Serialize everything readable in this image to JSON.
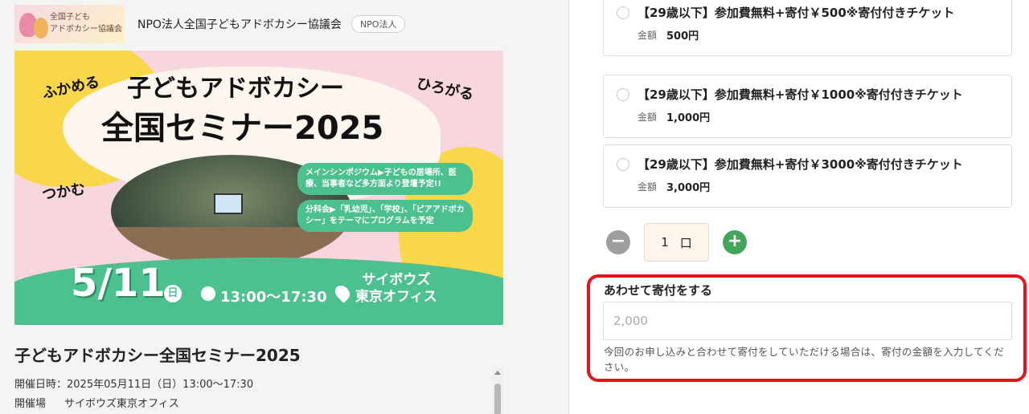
{
  "organizer": {
    "logo_text": [
      "全国子ども",
      "アドボカシー協議会"
    ],
    "name": "NPO法人全国子どもアドボカシー協議会",
    "badge": "NPO法人"
  },
  "banner": {
    "title_line1": "子どもアドボカシー",
    "title_line2": "全国セミナー2025",
    "word_left": "ふかめる",
    "word_right": "ひろがる",
    "word_lower": "つかむ",
    "pill1": "メインシンポジウム▶子どもの居場所、医療、当事者など多方面より登壇予定!!",
    "pill2": "分科会▶「乳幼児」、「学校」、「ピアアドボカシー」をテーマにプログラムを予定",
    "date": "5/11",
    "day": "日",
    "time": "13:00〜17:30",
    "venue_line1": "サイボウズ",
    "venue_line2": "東京オフィス"
  },
  "event": {
    "title": "子どもアドボカシー全国セミナー2025",
    "datetime": "開催日時：2025年05月11日（日）13:00〜17:30",
    "venue_label": "開催場",
    "venue": "サイボウズ東京オフィス"
  },
  "tickets": [
    {
      "name": "【29歳以下】参加費無料+寄付￥500※寄付付きチケット",
      "price_label": "金額",
      "price": "500円"
    },
    {
      "name": "【29歳以下】参加費無料+寄付￥1000※寄付付きチケット",
      "price_label": "金額",
      "price": "1,000円"
    },
    {
      "name": "【29歳以下】参加費無料+寄付￥3000※寄付付きチケット",
      "price_label": "金額",
      "price": "3,000円"
    }
  ],
  "quantity": {
    "minus": "−",
    "value": "1",
    "unit": "口",
    "plus": "+"
  },
  "donation": {
    "label": "あわせて寄付をする",
    "placeholder": "2,000",
    "help": "今回のお申し込みと合わせて寄付をしていただける場合は、寄付の金額を入力してください。"
  },
  "colors": {
    "accent_green": "#43a55c",
    "highlight_red": "#e8131a",
    "banner_green": "#4cc08f",
    "banner_yellow": "#f8d84a",
    "banner_pink": "#f7d6de"
  }
}
